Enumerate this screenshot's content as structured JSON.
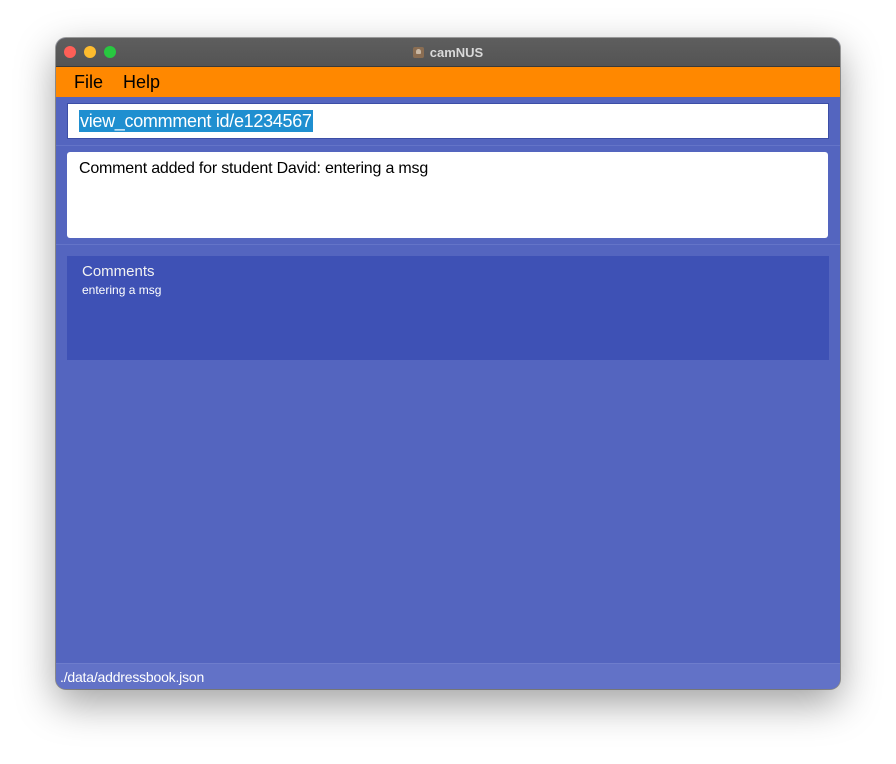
{
  "window": {
    "title": "camNUS"
  },
  "menu": {
    "items": [
      {
        "label": "File"
      },
      {
        "label": "Help"
      }
    ]
  },
  "command_box": {
    "value": "view_commment id/e1234567"
  },
  "result_display": {
    "text": "Comment added for student David: entering a msg"
  },
  "comments_panel": {
    "title": "Comments",
    "body": "entering a msg"
  },
  "status_bar": {
    "file_path": "./data/addressbook.json"
  },
  "colors": {
    "menu_bar": "#ff8800",
    "background": "#5465bf",
    "comments_panel": "#3e51b5",
    "selection": "#1f8fd0"
  },
  "icons": {
    "close": "close-traffic-light",
    "minimize": "minimize-traffic-light",
    "zoom": "zoom-traffic-light",
    "app": "app-icon"
  }
}
